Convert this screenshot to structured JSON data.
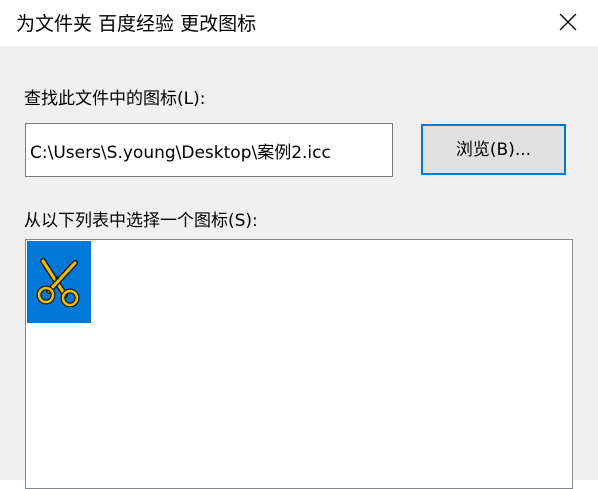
{
  "window": {
    "title": "为文件夹 百度经验 更改图标"
  },
  "dialog": {
    "find_label": "查找此文件中的图标(L):",
    "file_path": "C:\\Users\\S.young\\Desktop\\案例2.icc",
    "browse_label": "浏览(B)...",
    "choose_label": "从以下列表中选择一个图标(S):"
  },
  "icons": [
    {
      "name": "scissors-icon",
      "selected": true,
      "background": "#0078d7",
      "color": "#f0c000"
    }
  ]
}
